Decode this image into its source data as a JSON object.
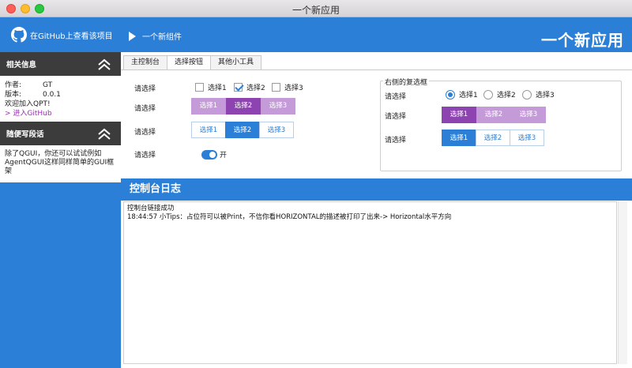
{
  "window": {
    "title": "一个新应用"
  },
  "header": {
    "github_label": "在GitHub上查看该项目",
    "new_component_label": "一个新组件",
    "app_title": "一个新应用"
  },
  "sidebar": {
    "info": {
      "title": "相关信息",
      "author_key": "作者:",
      "author_val": "GT",
      "version_key": "版本:",
      "version_val": "0.0.1",
      "welcome": "欢迎加入QPT!",
      "github_link": "> 进入GitHub"
    },
    "notes": {
      "title": "随便写段话",
      "text": "除了QGUI，你还可以试试例如AgentQGUI这样同样简单的GUI框架"
    }
  },
  "tabs": [
    "主控制台",
    "选择按钮",
    "其他小工具"
  ],
  "left_panel": {
    "row1_label": "请选择",
    "row2_label": "请选择",
    "row3_label": "请选择",
    "row4_label": "请选择",
    "checkboxes": [
      {
        "label": "选择1",
        "checked": false
      },
      {
        "label": "选择2",
        "checked": true
      },
      {
        "label": "选择3",
        "checked": false
      }
    ],
    "purple_segments": [
      "选择1",
      "选择2",
      "选择3"
    ],
    "blue_segments": [
      "选择1",
      "选择2",
      "选择3"
    ],
    "toggle_label": "开"
  },
  "right_group": {
    "title": "右侧的复选框",
    "row1_label": "请选择",
    "row2_label": "请选择",
    "row3_label": "请选择",
    "radios": [
      {
        "label": "选择1",
        "checked": true
      },
      {
        "label": "选择2",
        "checked": false
      },
      {
        "label": "选择3",
        "checked": false
      }
    ],
    "purple_segments": [
      "选择1",
      "选择2",
      "选择3"
    ],
    "blue_segments": [
      "选择1",
      "选择2",
      "选择3"
    ]
  },
  "console": {
    "title": "控制台日志",
    "lines": [
      "控制台链接成功",
      "18:44:57    小Tips：占位符可以被Print，不信你看HORIZONTAL的描述被打印了出来-> Horizontal水平方向"
    ]
  },
  "colors": {
    "accent": "#2b7fd6",
    "dark_header": "#3c3c3c",
    "purple": "#c49ad9",
    "purple_selected": "#8e44b0"
  }
}
